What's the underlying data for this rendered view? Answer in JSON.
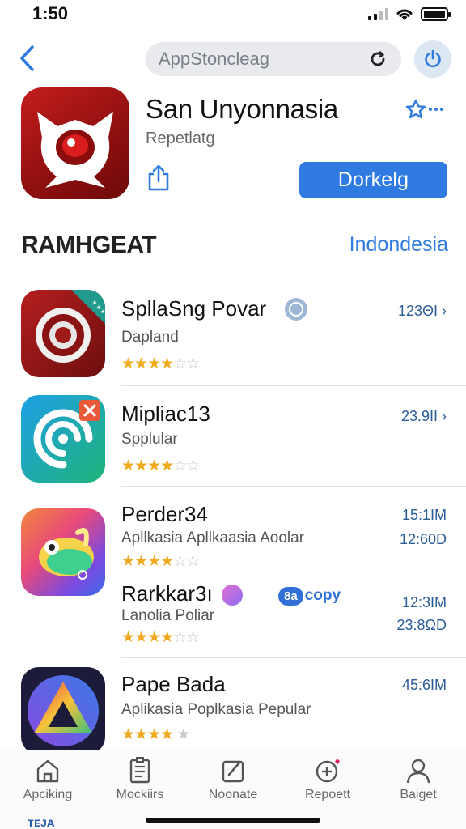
{
  "status": {
    "time": "1:50"
  },
  "nav": {
    "search_text": "AppStoncleag"
  },
  "hero": {
    "title": "San Unyonnasia",
    "subtitle": "Repetlatg",
    "download_label": "Dorkelg"
  },
  "section": {
    "title": "RAMHGEAT",
    "link": "Indondesia"
  },
  "apps": [
    {
      "name": "SpllaSng Povar",
      "category": "Dapland",
      "size": "123ΘΙ",
      "stars": "★★★★☆",
      "badge": "verified"
    },
    {
      "name": "Mipliac13",
      "category": "Spplular",
      "size": "23.9ΙΙ",
      "stars": "★★★★☆"
    },
    {
      "name": "Perder34",
      "category": "Apllkasia Apllkaasia Aoolar",
      "size": "15:1ΙΜ",
      "size2": "12:60D",
      "stars": "★★★★☆"
    },
    {
      "name": "Rarkkar3ı",
      "category": "Lanolia Poliar",
      "size": "12:3ΙΜ",
      "size2": "23:8ΩD",
      "stars": "★★★★☆",
      "tag": "copy",
      "tag_prefix": "8a"
    },
    {
      "name": "Pape Bada",
      "category": "Aplikasia Poplkasia Pepular",
      "size": "45:6ΙΜ",
      "stars": "★★★★ ★"
    }
  ],
  "tabs": [
    {
      "label": "Apciking",
      "icon": "home-icon"
    },
    {
      "label": "Mockiirs",
      "icon": "document-icon"
    },
    {
      "label": "Noonate",
      "icon": "edit-icon"
    },
    {
      "label": "Repoett",
      "icon": "plus-circle-icon"
    },
    {
      "label": "Baiget",
      "icon": "person-icon"
    }
  ],
  "colors": {
    "accent": "#2f7be2",
    "star": "#f0a81c"
  },
  "bottom_fragment": "ᴛᴇᴊᴀ"
}
